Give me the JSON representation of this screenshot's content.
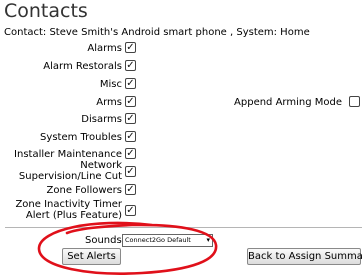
{
  "page": {
    "title": "Contacts",
    "contact_line": "Contact: Steve Smith's Android smart phone , System: Home"
  },
  "options": [
    {
      "label": "Alarms",
      "checked": true
    },
    {
      "label": "Alarm Restorals",
      "checked": true
    },
    {
      "label": "Misc",
      "checked": true
    },
    {
      "label": "Arms",
      "checked": true
    },
    {
      "label": "Disarms",
      "checked": true
    },
    {
      "label": "System Troubles",
      "checked": true
    },
    {
      "label": "Installer Maintenance",
      "checked": true
    },
    {
      "label": "Network Supervision/Line Cut",
      "checked": true
    },
    {
      "label": "Zone Followers",
      "checked": true
    },
    {
      "label": "Zone Inactivity Timer Alert (Plus Feature)",
      "checked": true
    }
  ],
  "append": {
    "label": "Append Arming Mode",
    "checked": false
  },
  "check_glyph": "✓",
  "sounds": {
    "label": "Sounds",
    "value": "Connect2Go Default",
    "arrow": "▾"
  },
  "buttons": {
    "set_alerts": "Set Alerts",
    "back": "Back to Assign Summary"
  },
  "colors": {
    "annotation": "#e0101a",
    "title": "#333333"
  }
}
